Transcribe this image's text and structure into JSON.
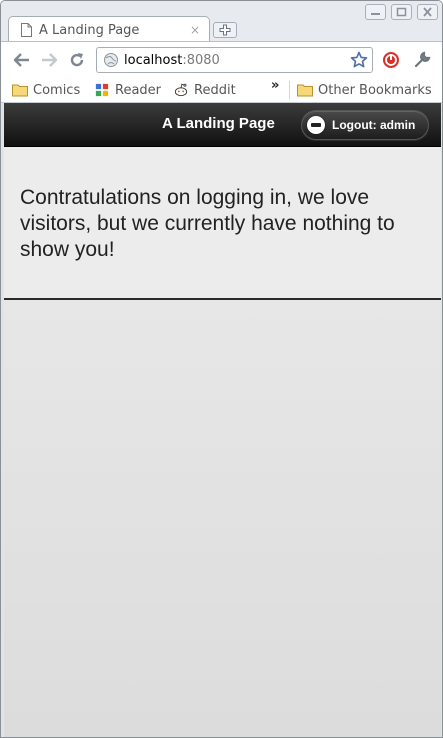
{
  "browser": {
    "tab": {
      "title": "A Landing Page",
      "close_glyph": "×"
    },
    "window_controls": [
      "minimize-icon",
      "restore-icon",
      "close-icon"
    ],
    "address": {
      "host": "localhost",
      "port": ":8080"
    },
    "bookmarks": [
      {
        "label": "Comics",
        "icon": "folder-icon"
      },
      {
        "label": "Reader",
        "icon": "google-reader-icon"
      },
      {
        "label": "Reddit",
        "icon": "reddit-icon"
      }
    ],
    "bookmarks_overflow": "»",
    "other_bookmarks": "Other Bookmarks"
  },
  "page": {
    "header": {
      "title": "A Landing Page",
      "logout_label": "Logout: admin"
    },
    "message": "Contratulations on logging in, we love visitors, but we currently have nothing to show you!"
  },
  "colors": {
    "header_bg": "#1a1a1a",
    "page_bg": "#ececec",
    "divider": "#2a2a2a",
    "stop_ext": "#d9312a"
  }
}
